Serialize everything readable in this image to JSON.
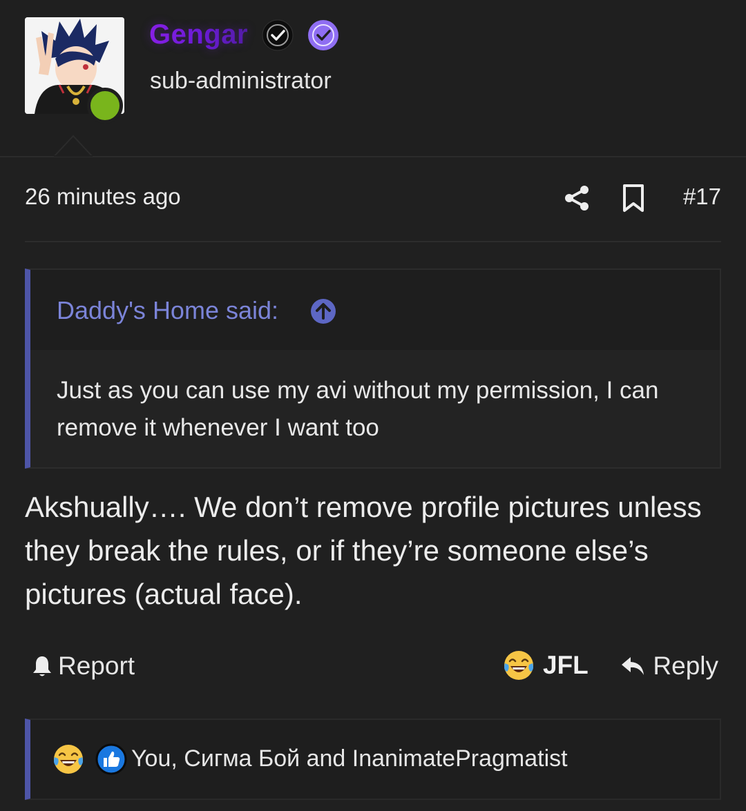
{
  "author": {
    "name": "Gengar",
    "role": "sub-administrator",
    "avatar_icon": "anime-avatar",
    "status": "online",
    "status_color": "#79b51c",
    "badges": [
      "verified-black-icon",
      "verified-purple-icon"
    ]
  },
  "post": {
    "timestamp": "26 minutes ago",
    "number": "#17",
    "quote": {
      "author_label": "Daddy's Home said:",
      "text": "Just as you can use my avi without my permission, I can remove it whenever I want too"
    },
    "body": "Akshually…. We don’t remove profile pictures unless they break the rules, or if they’re someone else’s pictures (actual face)."
  },
  "actions": {
    "report_label": "Report",
    "reaction_label": "JFL",
    "reply_label": "Reply"
  },
  "reactions": {
    "text": "You, Сигма Бой and InanimatePragmatist",
    "icons": [
      "laughing-crying-emoji",
      "thumbs-up-icon"
    ]
  },
  "colors": {
    "background": "#202020",
    "accent": "#4e55a8",
    "quote_author": "#7b84d8",
    "username_gradient": [
      "#8a1fe8",
      "#4e1c9e"
    ]
  }
}
